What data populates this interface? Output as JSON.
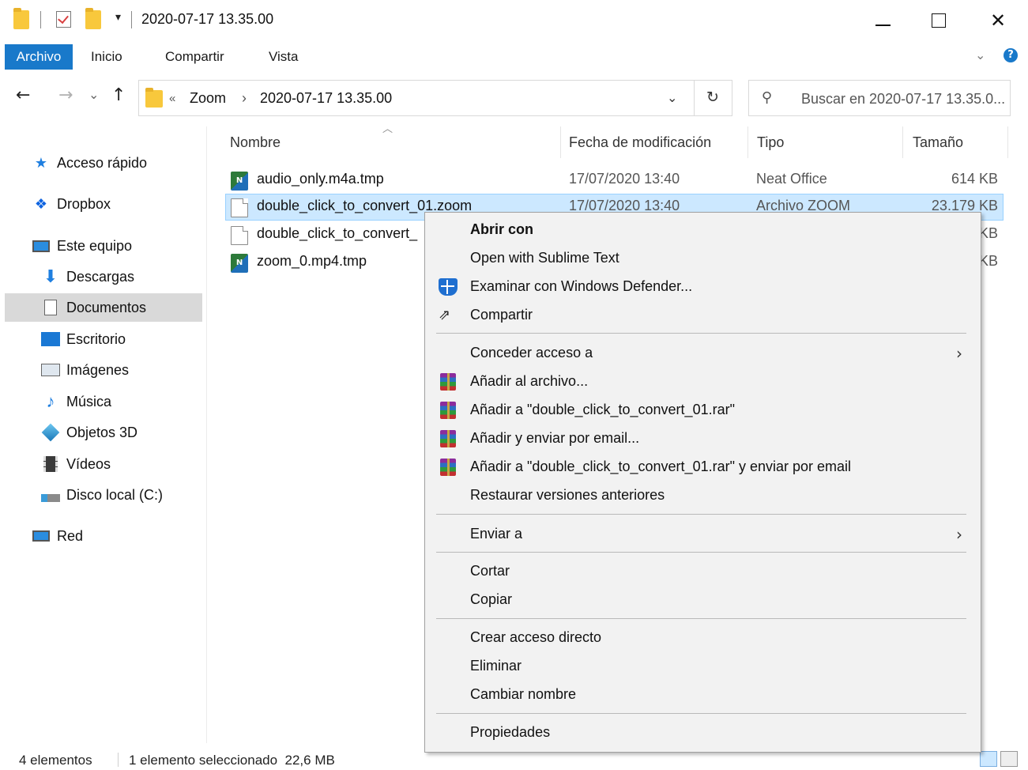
{
  "window": {
    "title": "2020-07-17 13.35.00",
    "minimize": "—",
    "maximize": "☐",
    "close": "✕"
  },
  "ribbon": {
    "tabs": [
      "Archivo",
      "Inicio",
      "Compartir",
      "Vista"
    ]
  },
  "address": {
    "back": "←",
    "forward": "→",
    "history": "⌄",
    "up": "↑",
    "prefix": "«",
    "crumb_1": "Zoom",
    "separator": "›",
    "crumb_2": "2020-07-17 13.35.00",
    "refresh": "↻",
    "search_placeholder": "Buscar en 2020-07-17 13.35.0..."
  },
  "nav": {
    "items": [
      {
        "label": "Acceso rápido",
        "icon": "star-icon"
      },
      {
        "label": "Dropbox",
        "icon": "dropbox-icon"
      },
      {
        "label": "Este equipo",
        "icon": "computer-icon"
      },
      {
        "label": "Descargas",
        "icon": "download-icon"
      },
      {
        "label": "Documentos",
        "icon": "documents-icon"
      },
      {
        "label": "Escritorio",
        "icon": "desktop-icon"
      },
      {
        "label": "Imágenes",
        "icon": "pictures-icon"
      },
      {
        "label": "Música",
        "icon": "music-icon"
      },
      {
        "label": "Objetos 3D",
        "icon": "cube-icon"
      },
      {
        "label": "Vídeos",
        "icon": "video-icon"
      },
      {
        "label": "Disco local (C:)",
        "icon": "drive-icon"
      },
      {
        "label": "Red",
        "icon": "network-icon"
      }
    ]
  },
  "columns": {
    "name": "Nombre",
    "modified": "Fecha de modificación",
    "type": "Tipo",
    "size": "Tamaño"
  },
  "files": [
    {
      "name": "audio_only.m4a.tmp",
      "modified": "17/07/2020 13:40",
      "type": "Neat Office",
      "size": "614 KB"
    },
    {
      "name": "double_click_to_convert_01.zoom",
      "modified": "17/07/2020 13:40",
      "type": "Archivo ZOOM",
      "size": "23.179 KB"
    },
    {
      "name": "double_click_to_convert_",
      "modified": "",
      "type": "",
      "size": "KB"
    },
    {
      "name": "zoom_0.mp4.tmp",
      "modified": "",
      "type": "",
      "size": "KB"
    }
  ],
  "context_menu": {
    "open_with": "Abrir con",
    "sublime": "Open with Sublime Text",
    "defender": "Examinar con Windows Defender...",
    "share": "Compartir",
    "grant_access": "Conceder acceso a",
    "add_archive": "Añadir al archivo...",
    "add_rar": "Añadir a \"double_click_to_convert_01.rar\"",
    "add_email": "Añadir y enviar por email...",
    "add_rar_email": "Añadir a \"double_click_to_convert_01.rar\" y enviar por email",
    "restore": "Restaurar versiones anteriores",
    "send_to": "Enviar a",
    "cut": "Cortar",
    "copy": "Copiar",
    "shortcut": "Crear acceso directo",
    "delete": "Eliminar",
    "rename": "Cambiar nombre",
    "properties": "Propiedades",
    "submenu_arrow": "›"
  },
  "status": {
    "count": "4 elementos",
    "selection": "1 elemento seleccionado  22,6 MB"
  },
  "colors": {
    "accent": "#1979ca",
    "selection": "#cce8ff",
    "menu_bg": "#f2f2f2"
  }
}
